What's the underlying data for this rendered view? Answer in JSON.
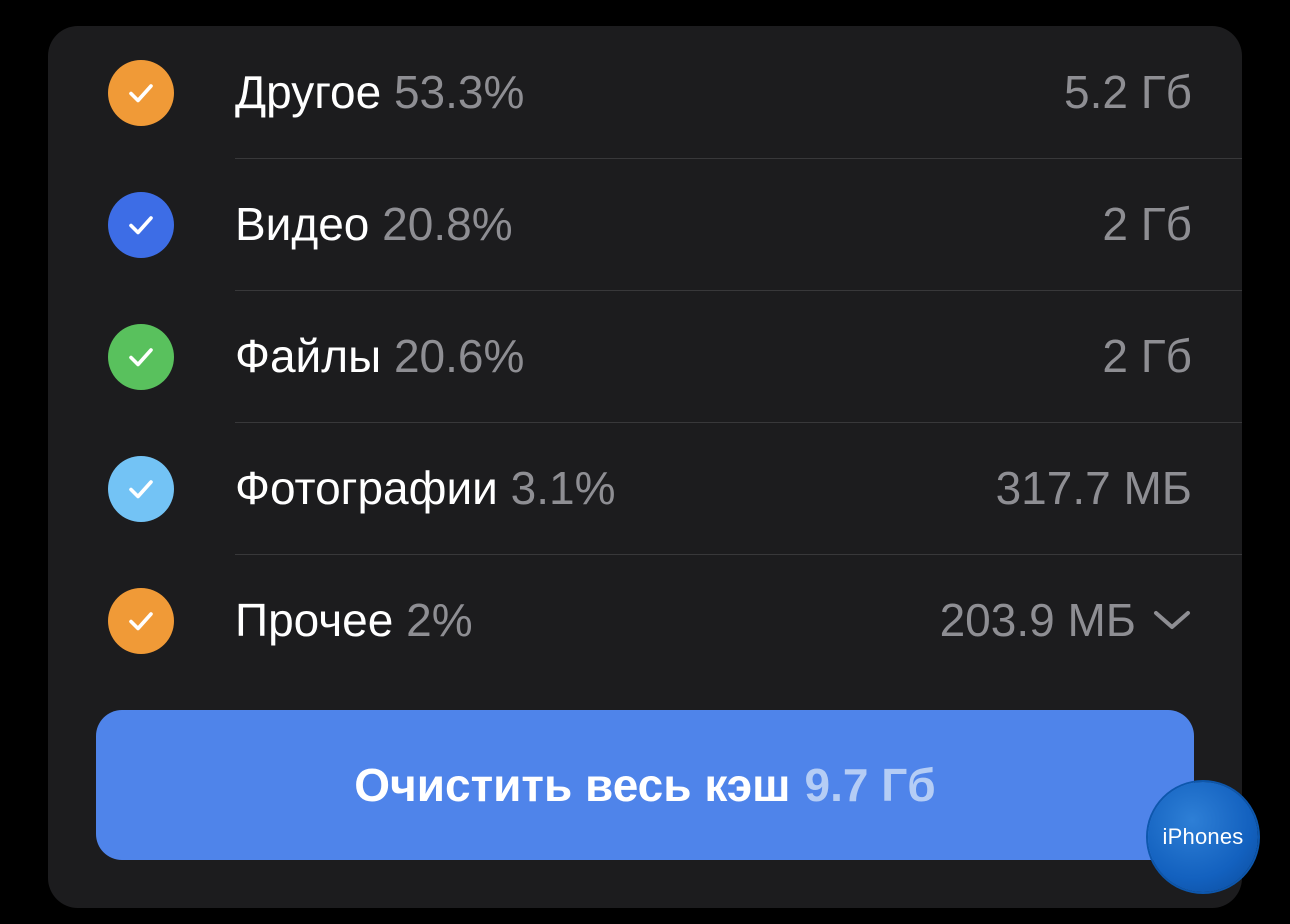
{
  "items": [
    {
      "name": "Другое",
      "percent": "53.3%",
      "size": "5.2 Гб",
      "color": "#f09a37"
    },
    {
      "name": "Видео",
      "percent": "20.8%",
      "size": "2 Гб",
      "color": "#3d6de6"
    },
    {
      "name": "Файлы",
      "percent": "20.6%",
      "size": "2 Гб",
      "color": "#59c15d"
    },
    {
      "name": "Фотографии",
      "percent": "3.1%",
      "size": "317.7 МБ",
      "color": "#73c3f5"
    },
    {
      "name": "Прочее",
      "percent": "2%",
      "size": "203.9 МБ",
      "color": "#f09a37"
    }
  ],
  "clear_button": {
    "label": "Очистить весь кэш",
    "size": "9.7 Гб",
    "color": "#4f84ea"
  },
  "watermark": {
    "text": "iPhones"
  }
}
